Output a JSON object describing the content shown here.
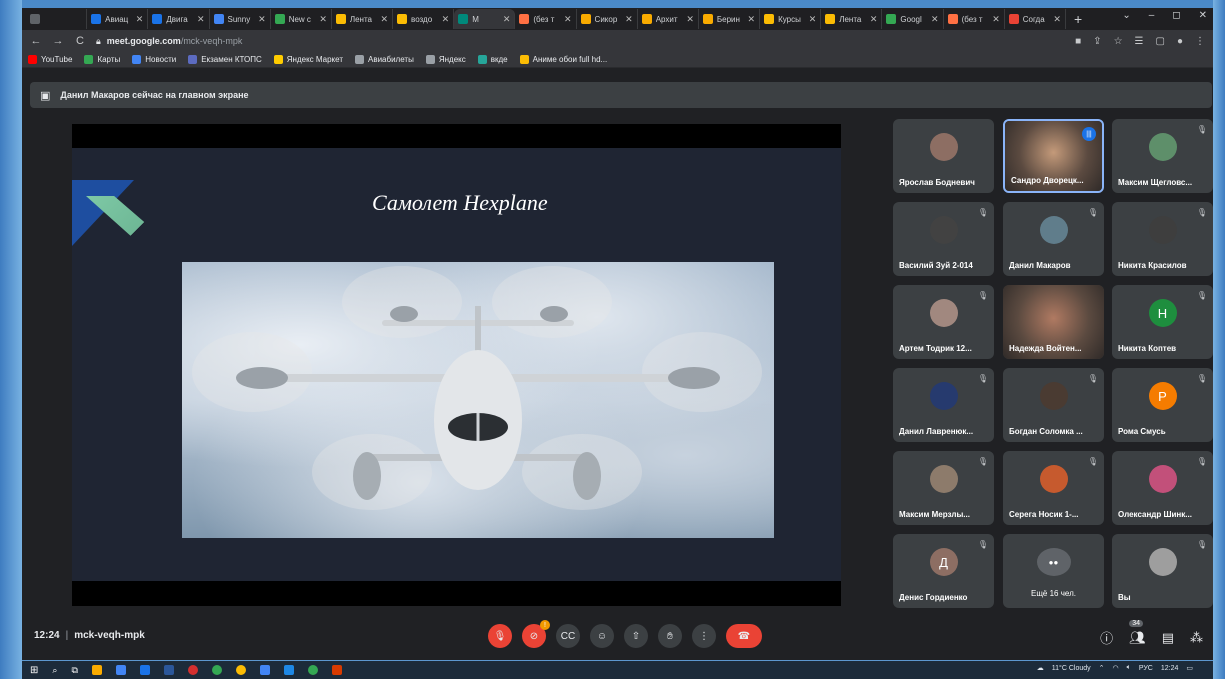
{
  "browser": {
    "tabs": [
      {
        "label": "",
        "color": "#5f6368"
      },
      {
        "label": "Авиац",
        "color": "#1a73e8"
      },
      {
        "label": "Двига",
        "color": "#1a73e8"
      },
      {
        "label": "Sunny",
        "color": "#4285f4"
      },
      {
        "label": "New c",
        "color": "#34a853"
      },
      {
        "label": "Лента",
        "color": "#fbbc04"
      },
      {
        "label": "воздо",
        "color": "#fbbc04"
      },
      {
        "label": "M",
        "color": "#00897b",
        "active": true
      },
      {
        "label": "(без т",
        "color": "#ff7043"
      },
      {
        "label": "Сикор",
        "color": "#f9ab00"
      },
      {
        "label": "Архит",
        "color": "#f9ab00"
      },
      {
        "label": "Берин",
        "color": "#f9ab00"
      },
      {
        "label": "Курсы",
        "color": "#fbbc04"
      },
      {
        "label": "Лента",
        "color": "#fbbc04"
      },
      {
        "label": "Googl",
        "color": "#34a853"
      },
      {
        "label": "(без т",
        "color": "#ff7043"
      },
      {
        "label": "Согда",
        "color": "#ea4335"
      }
    ],
    "url_host": "meet.google.com",
    "url_path": "/mck-veqh-mpk",
    "bookmarks": [
      {
        "label": "YouTube",
        "color": "#ff0000"
      },
      {
        "label": "Карты",
        "color": "#34a853"
      },
      {
        "label": "Новости",
        "color": "#4285f4"
      },
      {
        "label": "Екзамен КТОПС",
        "color": "#5c6bc0"
      },
      {
        "label": "Яндекс Маркет",
        "color": "#ffcc00"
      },
      {
        "label": "Авиабилеты",
        "color": "#9aa0a6"
      },
      {
        "label": "Яндекс",
        "color": "#9aa0a6"
      },
      {
        "label": "вкде",
        "color": "#26a69a"
      },
      {
        "label": "Аниме обои full hd...",
        "color": "#fbbc04"
      }
    ]
  },
  "meet": {
    "banner": "Данил Макаров сейчас на главном экране",
    "slide_title": "Самолет Hexplane",
    "time": "12:24",
    "meeting_code": "mck-veqh-mpk",
    "participant_count": "34",
    "tiles": [
      {
        "name": "Ярослав Бодневич",
        "avatar_color": "#8d6e63",
        "muted": false,
        "kind": "avatar"
      },
      {
        "name": "Сандро Дворецк...",
        "avatar_color": "#c49a7a",
        "muted": false,
        "kind": "video",
        "speaking": true
      },
      {
        "name": "Максим Щегловс...",
        "avatar_color": "#5e8f6a",
        "muted": true,
        "kind": "avatar"
      },
      {
        "name": "Василий Зуй 2-014",
        "avatar_color": "#424242",
        "muted": true,
        "kind": "avatar"
      },
      {
        "name": "Данил Макаров",
        "avatar_color": "#607d8b",
        "muted": true,
        "kind": "avatar"
      },
      {
        "name": "Никита Красилов",
        "avatar_color": "#3e3e3e",
        "muted": true,
        "kind": "avatar"
      },
      {
        "name": "Артем Тодрик 12...",
        "avatar_color": "#a1887f",
        "muted": true,
        "kind": "avatar"
      },
      {
        "name": "Надежда Войтен...",
        "avatar_color": "#b07a62",
        "muted": false,
        "kind": "video"
      },
      {
        "name": "Никита Коптев",
        "avatar_color": "#1e8e3e",
        "muted": true,
        "kind": "letter",
        "letter": "Н"
      },
      {
        "name": "Данил Лавренюк...",
        "avatar_color": "#263a6e",
        "muted": true,
        "kind": "avatar"
      },
      {
        "name": "Богдан Соломка ...",
        "avatar_color": "#4a3b32",
        "muted": true,
        "kind": "avatar"
      },
      {
        "name": "Рома Смусь",
        "avatar_color": "#f57c00",
        "muted": true,
        "kind": "letter",
        "letter": "Р"
      },
      {
        "name": "Максим Мерзлы...",
        "avatar_color": "#8d7b6b",
        "muted": true,
        "kind": "avatar"
      },
      {
        "name": "Серега Носик 1-...",
        "avatar_color": "#c65a2e",
        "muted": true,
        "kind": "avatar"
      },
      {
        "name": "Олександр Шинк...",
        "avatar_color": "#c2507a",
        "muted": true,
        "kind": "avatar"
      },
      {
        "name": "Денис Гордиенко",
        "avatar_color": "#8d6e63",
        "muted": true,
        "kind": "letter",
        "letter": "Д"
      },
      {
        "name": "Ещё 16 чел.",
        "avatar_color": "#5f6368",
        "muted": false,
        "kind": "more"
      },
      {
        "name": "Вы",
        "avatar_color": "#9e9e9e",
        "muted": true,
        "kind": "avatar"
      }
    ]
  },
  "taskbar": {
    "weather": "11°C Cloudy",
    "lang": "РУС",
    "time": "12:24"
  }
}
